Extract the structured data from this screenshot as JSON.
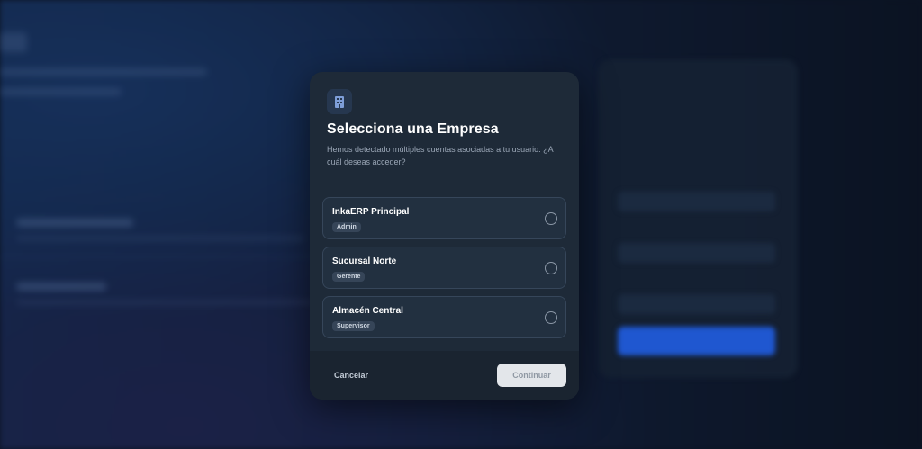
{
  "modal": {
    "title": "Selecciona una Empresa",
    "subtitle": "Hemos detectado múltiples cuentas asociadas a tu usuario. ¿A cuál deseas acceder?",
    "icon": "building-icon",
    "options": [
      {
        "name": "InkaERP Principal",
        "role": "Admin",
        "selected": false
      },
      {
        "name": "Sucursal Norte",
        "role": "Gerente",
        "selected": false
      },
      {
        "name": "Almacén Central",
        "role": "Supervisor",
        "selected": false
      }
    ],
    "cancel_label": "Cancelar",
    "continue_label": "Continuar"
  },
  "colors": {
    "modal_bg": "#1e2a38",
    "accent": "#1f57d0",
    "continue_disabled": "#e3e6ea"
  }
}
